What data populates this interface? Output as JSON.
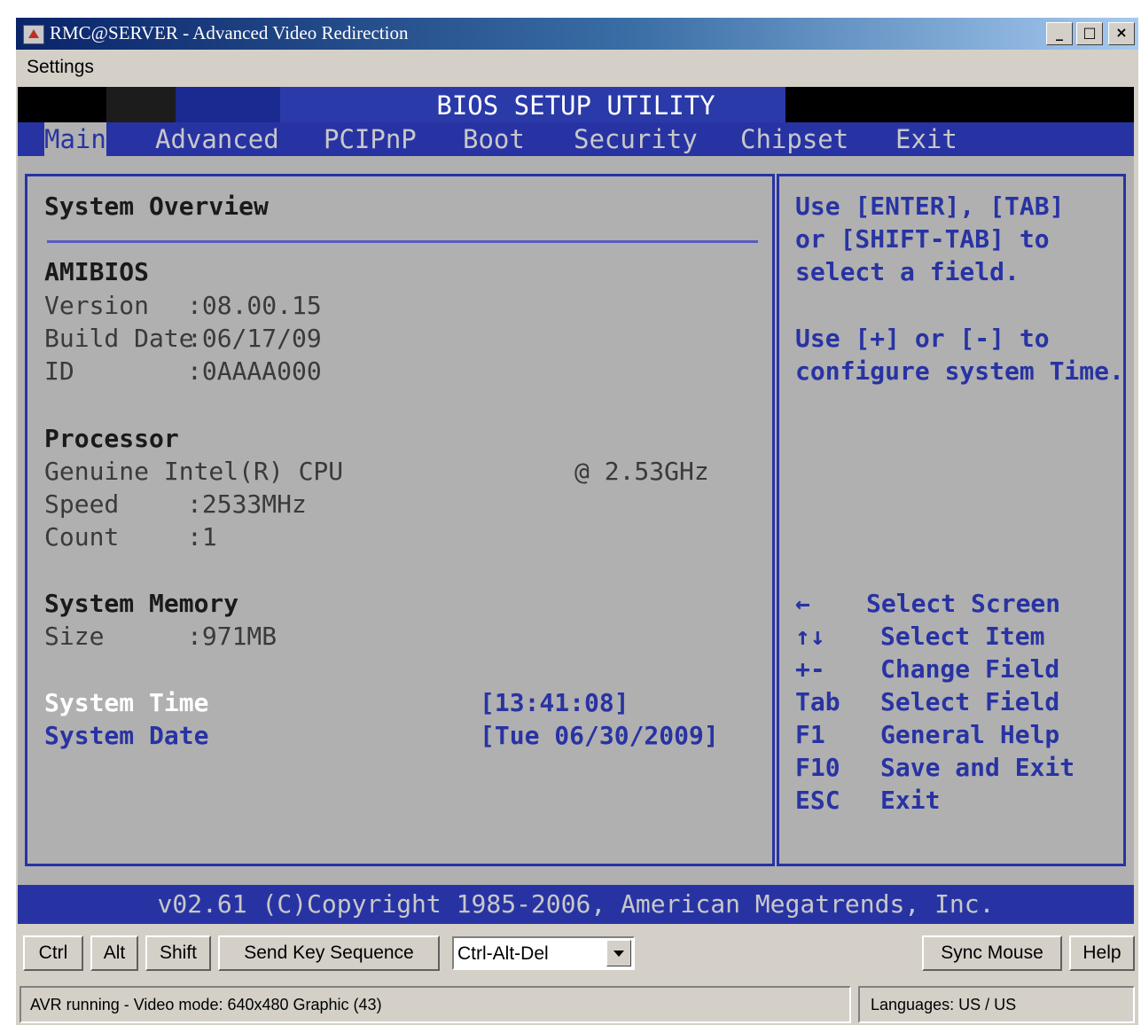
{
  "window": {
    "title": "RMC@SERVER - Advanced Video Redirection",
    "minimize_glyph": "_",
    "maximize_glyph": "□",
    "close_glyph": "×"
  },
  "menu": {
    "settings": "Settings"
  },
  "bios": {
    "header_title": "BIOS SETUP UTILITY",
    "tabs": [
      {
        "label": "Main",
        "active": true
      },
      {
        "label": "Advanced"
      },
      {
        "label": "PCIPnP"
      },
      {
        "label": "Boot"
      },
      {
        "label": "Security"
      },
      {
        "label": "Chipset"
      },
      {
        "label": "Exit"
      }
    ],
    "overview": {
      "heading": "System Overview",
      "amibios": {
        "heading": "AMIBIOS",
        "version_label": "Version",
        "version_value": ":08.00.15",
        "build_date_label": "Build Date",
        "build_date_value": ":06/17/09",
        "id_label": "ID",
        "id_value": ":0AAAA000"
      },
      "processor": {
        "heading": "Processor",
        "cpu_name": "Genuine Intel(R) CPU",
        "cpu_freq": "@ 2.53GHz",
        "speed_label": "Speed",
        "speed_value": ":2533MHz",
        "count_label": "Count",
        "count_value": ":1"
      },
      "memory": {
        "heading": "System Memory",
        "size_label": "Size",
        "size_value": ":971MB"
      },
      "system_time": {
        "label": "System Time",
        "open_bracket": "[",
        "hour": "13",
        "rest": ":41:08]"
      },
      "system_date": {
        "label": "System Date",
        "value": "[Tue 06/30/2009]"
      }
    },
    "help": {
      "line1": "Use [ENTER], [TAB]",
      "line2": "or [SHIFT-TAB] to",
      "line3": "select a field.",
      "line4": "Use [+] or [-] to",
      "line5": "configure system Time."
    },
    "keys": [
      {
        "key": "←",
        "desc": "Select Screen"
      },
      {
        "key": "↑↓",
        "desc": "Select Item"
      },
      {
        "key": "+-",
        "desc": "Change Field"
      },
      {
        "key": "Tab",
        "desc": "Select Field"
      },
      {
        "key": "F1",
        "desc": "General Help"
      },
      {
        "key": "F10",
        "desc": "Save and Exit"
      },
      {
        "key": "ESC",
        "desc": "Exit"
      }
    ],
    "copyright": "v02.61 (C)Copyright 1985-2006, American Megatrends, Inc.",
    "colors": {
      "background": "#b0b0b0",
      "accent": "#2833a3",
      "highlight": "#ffffff"
    }
  },
  "toolbar": {
    "ctrl": "Ctrl",
    "alt": "Alt",
    "shift": "Shift",
    "send_key_sequence": "Send Key Sequence",
    "key_sequence_selected": "Ctrl-Alt-Del",
    "sync_mouse": "Sync Mouse",
    "help": "Help"
  },
  "statusbar": {
    "left": "AVR running - Video mode: 640x480 Graphic (43)",
    "right": "Languages: US / US"
  }
}
